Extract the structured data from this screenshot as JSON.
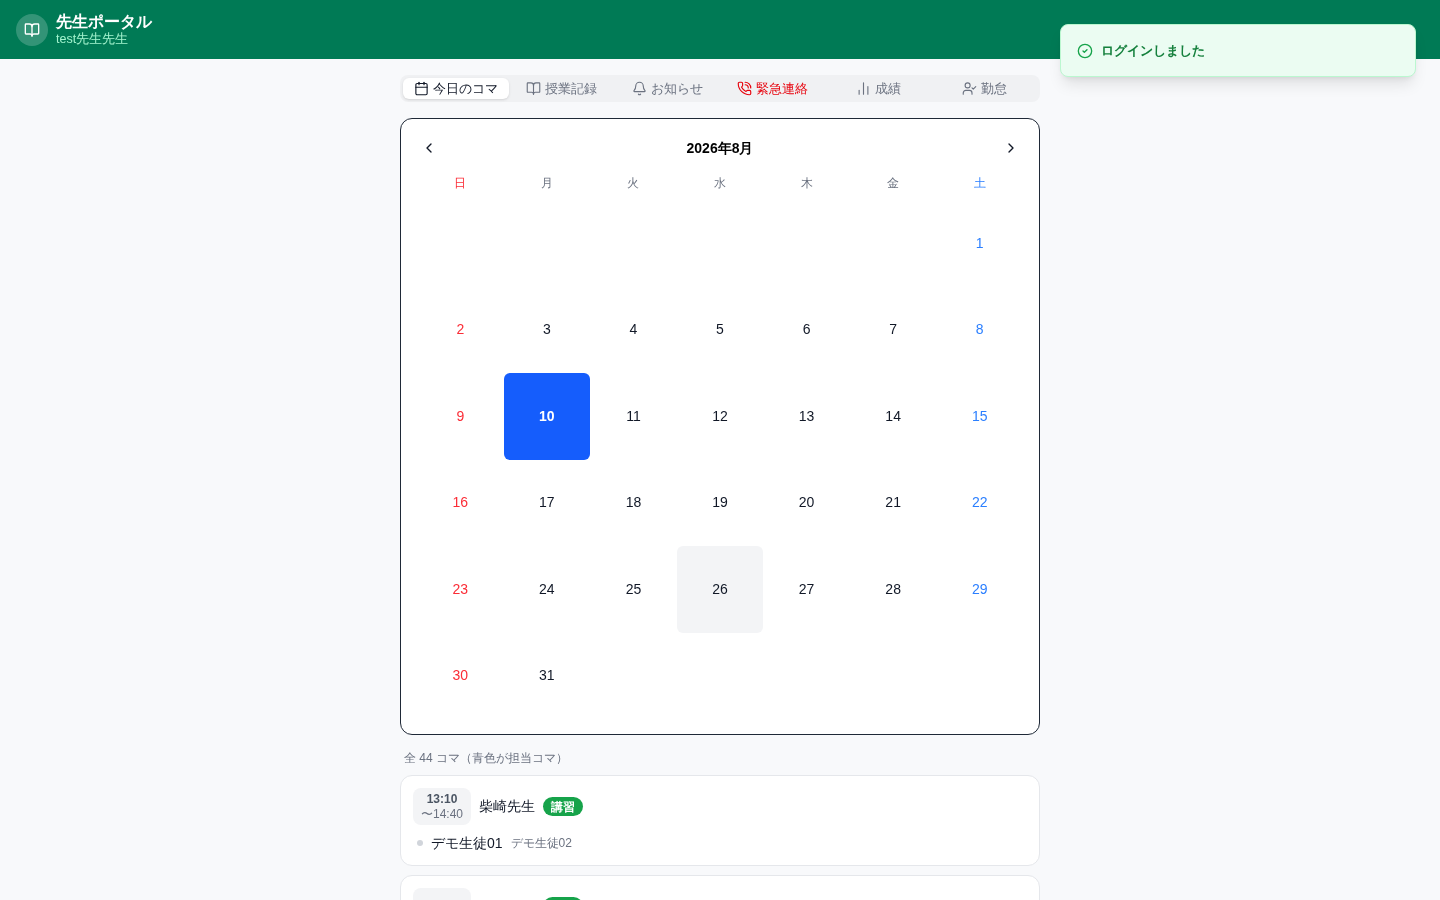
{
  "header": {
    "title": "先生ポータル",
    "subtitle": "test先生先生"
  },
  "toast": {
    "message": "ログインしました"
  },
  "tabs": [
    {
      "label": "今日のコマ",
      "selected": true,
      "kind": "normal"
    },
    {
      "label": "授業記録",
      "selected": false,
      "kind": "normal"
    },
    {
      "label": "お知らせ",
      "selected": false,
      "kind": "normal"
    },
    {
      "label": "緊急連絡",
      "selected": false,
      "kind": "alert"
    },
    {
      "label": "成績",
      "selected": false,
      "kind": "normal"
    },
    {
      "label": "勤怠",
      "selected": false,
      "kind": "normal"
    }
  ],
  "calendar": {
    "title": "2026年8月",
    "weekdays": [
      {
        "label": "日",
        "kind": "sunday"
      },
      {
        "label": "月",
        "kind": "weekday"
      },
      {
        "label": "火",
        "kind": "weekday"
      },
      {
        "label": "水",
        "kind": "weekday"
      },
      {
        "label": "木",
        "kind": "weekday"
      },
      {
        "label": "金",
        "kind": "weekday"
      },
      {
        "label": "土",
        "kind": "saturday"
      }
    ],
    "weeks": [
      [
        {
          "kind": "blank"
        },
        {
          "kind": "blank"
        },
        {
          "kind": "blank"
        },
        {
          "kind": "blank"
        },
        {
          "kind": "blank"
        },
        {
          "kind": "blank"
        },
        {
          "kind": "day",
          "day": "1",
          "selected": false,
          "today": false
        }
      ],
      [
        {
          "kind": "day",
          "day": "2",
          "selected": false,
          "today": false
        },
        {
          "kind": "day",
          "day": "3",
          "selected": false,
          "today": false
        },
        {
          "kind": "day",
          "day": "4",
          "selected": false,
          "today": false
        },
        {
          "kind": "day",
          "day": "5",
          "selected": false,
          "today": false
        },
        {
          "kind": "day",
          "day": "6",
          "selected": false,
          "today": false
        },
        {
          "kind": "day",
          "day": "7",
          "selected": false,
          "today": false
        },
        {
          "kind": "day",
          "day": "8",
          "selected": false,
          "today": false
        }
      ],
      [
        {
          "kind": "day",
          "day": "9",
          "selected": false,
          "today": false
        },
        {
          "kind": "day",
          "day": "10",
          "selected": true,
          "today": false
        },
        {
          "kind": "day",
          "day": "11",
          "selected": false,
          "today": false
        },
        {
          "kind": "day",
          "day": "12",
          "selected": false,
          "today": false
        },
        {
          "kind": "day",
          "day": "13",
          "selected": false,
          "today": false
        },
        {
          "kind": "day",
          "day": "14",
          "selected": false,
          "today": false
        },
        {
          "kind": "day",
          "day": "15",
          "selected": false,
          "today": false
        }
      ],
      [
        {
          "kind": "day",
          "day": "16",
          "selected": false,
          "today": false
        },
        {
          "kind": "day",
          "day": "17",
          "selected": false,
          "today": false
        },
        {
          "kind": "day",
          "day": "18",
          "selected": false,
          "today": false
        },
        {
          "kind": "day",
          "day": "19",
          "selected": false,
          "today": false
        },
        {
          "kind": "day",
          "day": "20",
          "selected": false,
          "today": false
        },
        {
          "kind": "day",
          "day": "21",
          "selected": false,
          "today": false
        },
        {
          "kind": "day",
          "day": "22",
          "selected": false,
          "today": false
        }
      ],
      [
        {
          "kind": "day",
          "day": "23",
          "selected": false,
          "today": false
        },
        {
          "kind": "day",
          "day": "24",
          "selected": false,
          "today": false
        },
        {
          "kind": "day",
          "day": "25",
          "selected": false,
          "today": false
        },
        {
          "kind": "day",
          "day": "26",
          "selected": false,
          "today": true
        },
        {
          "kind": "day",
          "day": "27",
          "selected": false,
          "today": false
        },
        {
          "kind": "day",
          "day": "28",
          "selected": false,
          "today": false
        },
        {
          "kind": "day",
          "day": "29",
          "selected": false,
          "today": false
        }
      ],
      [
        {
          "kind": "day",
          "day": "30",
          "selected": false,
          "today": false
        },
        {
          "kind": "day",
          "day": "31",
          "selected": false,
          "today": false
        },
        {
          "kind": "blank"
        },
        {
          "kind": "blank"
        },
        {
          "kind": "blank"
        },
        {
          "kind": "blank"
        },
        {
          "kind": "blank"
        }
      ]
    ]
  },
  "summary": "全 44 コマ（青色が担当コマ）",
  "sessions": [
    {
      "start": "13:10",
      "end": "〜14:40",
      "teacher": "柴崎先生",
      "kind": "lecture",
      "badge": "講習",
      "students": [
        {
          "name": "デモ生徒01",
          "primary": true
        },
        {
          "name": "デモ生徒02",
          "primary": false
        }
      ]
    },
    {
      "kind": "lecture"
    }
  ]
}
